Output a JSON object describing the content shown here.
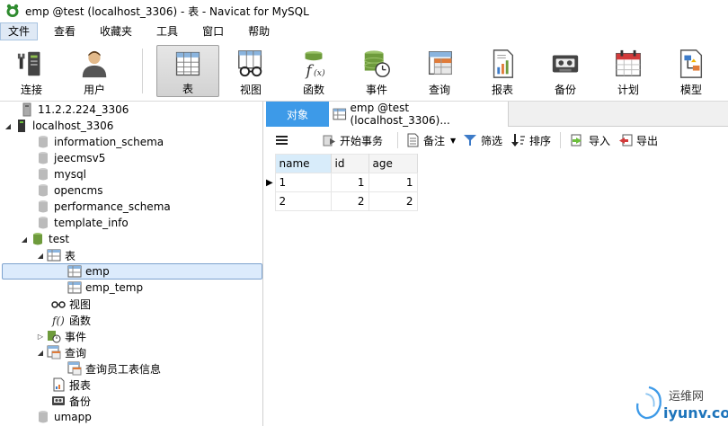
{
  "window": {
    "title": "emp @test (localhost_3306) - 表 - Navicat for MySQL"
  },
  "menu": [
    {
      "label": "文件",
      "active": true
    },
    {
      "label": "查看"
    },
    {
      "label": "收藏夹"
    },
    {
      "label": "工具"
    },
    {
      "label": "窗口"
    },
    {
      "label": "帮助"
    }
  ],
  "toolbar": {
    "connect": "连接",
    "user": "用户",
    "table": "表",
    "view": "视图",
    "function": "函数",
    "event": "事件",
    "query": "查询",
    "report": "报表",
    "backup": "备份",
    "schedule": "计划",
    "model": "模型"
  },
  "tree": {
    "conn1": "11.2.2.224_3306",
    "conn2": "localhost_3306",
    "db_information_schema": "information_schema",
    "db_jeecmsv5": "jeecmsv5",
    "db_mysql": "mysql",
    "db_opencms": "opencms",
    "db_performance_schema": "performance_schema",
    "db_template_info": "template_info",
    "db_test": "test",
    "tables": "表",
    "table_emp": "emp",
    "table_emp_temp": "emp_temp",
    "views": "视图",
    "functions": "函数",
    "events": "事件",
    "queries": "查询",
    "query_item": "查询员工表信息",
    "reports": "报表",
    "backups": "备份",
    "db_umapp": "umapp"
  },
  "tabs": {
    "objects": "对象",
    "emp_tab": "emp @test (localhost_3306)..."
  },
  "subtoolbar": {
    "begin_tx": "开始事务",
    "memo": "备注",
    "filter": "筛选",
    "sort": "排序",
    "import": "导入",
    "export": "导出"
  },
  "grid": {
    "columns": [
      "name",
      "id",
      "age"
    ],
    "rows": [
      [
        "1",
        "1",
        "1"
      ],
      [
        "2",
        "2",
        "2"
      ]
    ]
  },
  "watermark": {
    "line1": "运维网",
    "line2": "iyunv.com"
  },
  "colors": {
    "accent": "#3d9ae8",
    "selection": "#dcebfc"
  }
}
